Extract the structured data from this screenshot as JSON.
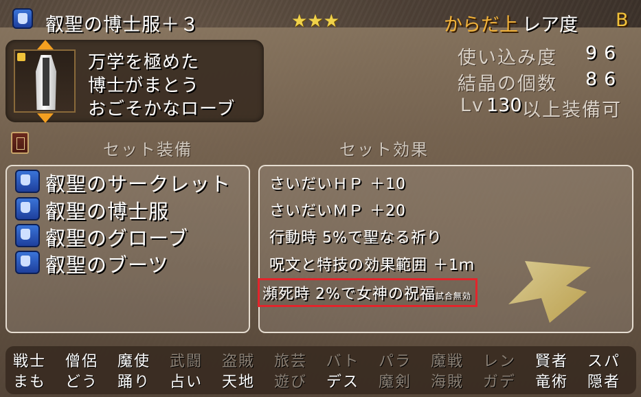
{
  "item": {
    "name": "叡聖の博士服＋３",
    "stars": "★★★",
    "slot_type": "からだ上",
    "rarity_label": "レア度",
    "rarity": "B",
    "description": [
      "万学を極めた",
      "博士がまとう",
      "おごそかなローブ"
    ]
  },
  "stats": {
    "usage_label": "使い込み度",
    "usage_value": "96",
    "crystal_label": "結晶の個数",
    "crystal_value": "86",
    "level_prefix": "Lv",
    "level_value": "130",
    "level_suffix": "以上装備可"
  },
  "sections": {
    "set_equipment": "セット装備",
    "set_effect": "セット効果"
  },
  "set_items": [
    {
      "name": "叡聖のサークレット",
      "icon": "helmet-icon"
    },
    {
      "name": "叡聖の博士服",
      "icon": "body-armor-icon"
    },
    {
      "name": "叡聖のグローブ",
      "icon": "glove-icon"
    },
    {
      "name": "叡聖のブーツ",
      "icon": "boot-icon"
    }
  ],
  "set_effects": [
    "さいだいＨＰ ＋10",
    "さいだいＭＰ ＋20",
    "行動時 5%で聖なる祈り",
    "呪文と特技の効果範囲 ＋1ｍ",
    "瀕死時 2%で女神の祝福"
  ],
  "set_effect_note": "試合無効",
  "jobs_row1": [
    {
      "label": "戦士",
      "active": true
    },
    {
      "label": "僧侶",
      "active": true
    },
    {
      "label": "魔使",
      "active": true
    },
    {
      "label": "武闘",
      "active": false
    },
    {
      "label": "盗賊",
      "active": false
    },
    {
      "label": "旅芸",
      "active": false
    },
    {
      "label": "バト",
      "active": false
    },
    {
      "label": "パラ",
      "active": false
    },
    {
      "label": "魔戦",
      "active": false
    },
    {
      "label": "レン",
      "active": false
    },
    {
      "label": "賢者",
      "active": true
    },
    {
      "label": "スパ",
      "active": true
    }
  ],
  "jobs_row2": [
    {
      "label": "まも",
      "active": true
    },
    {
      "label": "どう",
      "active": true
    },
    {
      "label": "踊り",
      "active": true
    },
    {
      "label": "占い",
      "active": true
    },
    {
      "label": "天地",
      "active": true
    },
    {
      "label": "遊び",
      "active": false
    },
    {
      "label": "デス",
      "active": true
    },
    {
      "label": "魔剣",
      "active": false
    },
    {
      "label": "海賊",
      "active": false
    },
    {
      "label": "ガデ",
      "active": false
    },
    {
      "label": "竜術",
      "active": true
    },
    {
      "label": "隠者",
      "active": true
    }
  ],
  "colors": {
    "slot_type": "#f2b33a",
    "rarity": "#f2c23a",
    "highlight_border": "#e3242b",
    "job_active": "#ffffff",
    "job_inactive": "#8b8176"
  }
}
